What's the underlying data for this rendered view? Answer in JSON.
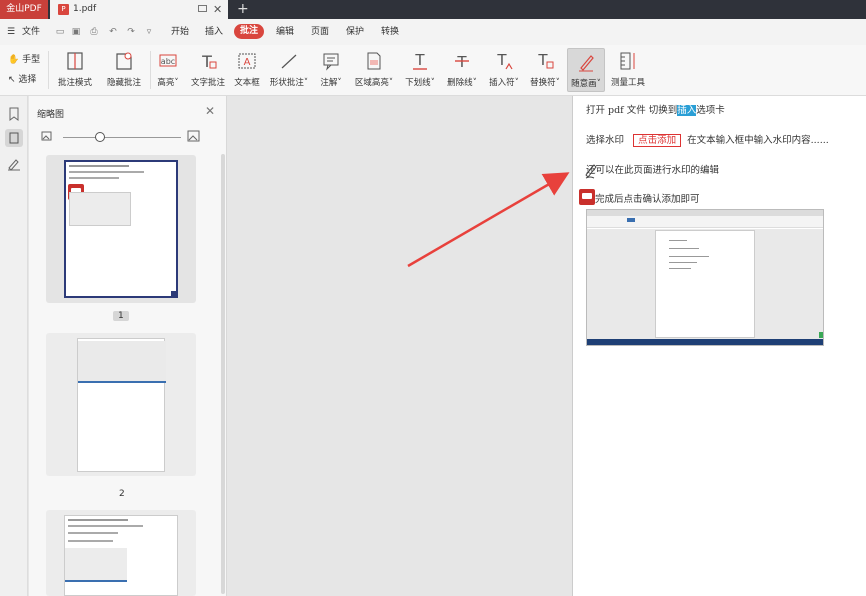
{
  "titlebar": {
    "app_name": "金山PDF",
    "doc_tab": "1.pdf",
    "pdf_badge": "P",
    "close": "✕",
    "new_tab": "+"
  },
  "menubar": {
    "file": "文件",
    "tabs": [
      "开始",
      "插入",
      "批注",
      "编辑",
      "页面",
      "保护",
      "转换"
    ],
    "active_tab": "批注"
  },
  "toolbar": {
    "hand": "手型",
    "select": "选择",
    "tools": [
      "批注模式",
      "隐藏批注",
      "高亮",
      "文字批注",
      "文本框",
      "形状批注",
      "注解",
      "区域高亮",
      "下划线",
      "删除线",
      "插入符",
      "替换符",
      "随意画",
      "测量工具"
    ],
    "selected_tool": "随意画"
  },
  "panel": {
    "title": "缩略图",
    "close": "✕",
    "pages": [
      "1",
      "2"
    ]
  },
  "document": {
    "line1_a": "打开 pdf 文件   切换到",
    "line1_hl": "插入",
    "line1_b": "选项卡",
    "line2_a": "选择水印",
    "line2_box": "点击添加",
    "line2_b": "在文本输入框中输入水印内容......",
    "line3": "还可以在此页面进行水印的编辑",
    "line4": "完成后点击确认添加即可"
  },
  "colors": {
    "accent": "#d9463e",
    "highlight": "#2a9fd6",
    "arrow": "#e8413c"
  }
}
